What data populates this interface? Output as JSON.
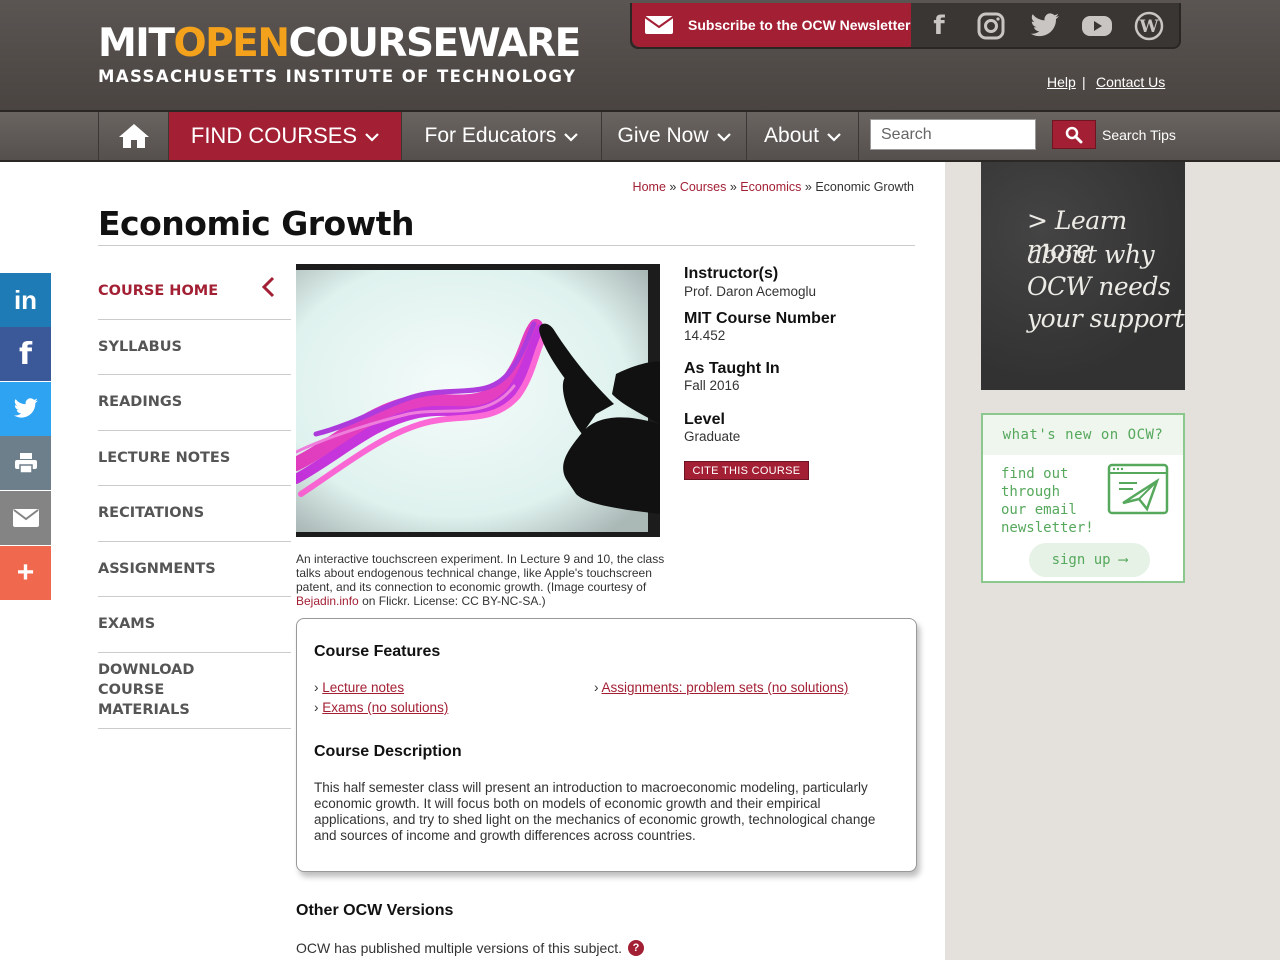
{
  "header": {
    "logo_part1": "MIT",
    "logo_part2": "OPEN",
    "logo_part3": "COURSEWARE",
    "logo_subtitle": "MASSACHUSETTS INSTITUTE OF TECHNOLOGY",
    "subscribe_label": "Subscribe to the OCW Newsletter",
    "social": [
      {
        "icon": "facebook-icon",
        "glyph": "f"
      },
      {
        "icon": "instagram-icon",
        "glyph": ""
      },
      {
        "icon": "twitter-icon",
        "glyph": ""
      },
      {
        "icon": "youtube-icon",
        "glyph": ""
      },
      {
        "icon": "wordpress-icon",
        "glyph": ""
      }
    ],
    "help": "Help",
    "separator": "|",
    "contact": "Contact Us"
  },
  "nav": {
    "find_courses": "FIND COURSES",
    "for_educators": "For Educators",
    "give_now": "Give Now",
    "about": "About",
    "search_placeholder": "Search",
    "search_tips": "Search Tips"
  },
  "breadcrumb": {
    "home": "Home",
    "courses": "Courses",
    "economics": "Economics",
    "current": "Economic Growth",
    "sep": "»"
  },
  "page_title": "Economic Growth",
  "left_nav": [
    "COURSE HOME",
    "SYLLABUS",
    "READINGS",
    "LECTURE NOTES",
    "RECITATIONS",
    "ASSIGNMENTS",
    "EXAMS",
    "DOWNLOAD COURSE MATERIALS"
  ],
  "caption": {
    "text": "An interactive touchscreen experiment. In Lecture 9 and 10, the class talks about endogenous technical change, like Apple's touchscreen patent, and its connection to economic growth. (Image courtesy of",
    "link": "Bejadin.info",
    "tail": "on Flickr. License: CC BY-NC-SA.)"
  },
  "course_info": {
    "instructor_label": "Instructor(s)",
    "instructor": "Prof. Daron Acemoglu",
    "number_label": "MIT Course Number",
    "number": "14.452",
    "taught_label": "As Taught In",
    "taught": "Fall 2016",
    "level_label": "Level",
    "level": "Graduate",
    "cite": "CITE THIS COURSE"
  },
  "features": {
    "heading": "Course Features",
    "items": [
      "Lecture notes",
      "Assignments: problem sets (no solutions)",
      "Exams (no solutions)"
    ],
    "bullet": "›"
  },
  "description": {
    "heading": "Course Description",
    "text": "This half semester class will present an introduction to macroeconomic modeling, particularly economic growth. It will focus both on models of economic growth and their empirical applications, and try to shed light on the mechanics of economic growth, technological change and sources of income and growth differences across countries."
  },
  "other_versions": {
    "heading": "Other OCW Versions",
    "text": "OCW has published multiple versions of this subject.",
    "help": "?"
  },
  "sidebar": {
    "chalk_lines": [
      "> Learn more",
      "about why",
      "OCW needs",
      "your support"
    ],
    "whats_new": "what's new on OCW?",
    "newsletter_lines": [
      "find out",
      "through",
      "our email",
      "newsletter!"
    ],
    "signup": "sign up ⟶"
  },
  "share": [
    {
      "name": "share-linkedin",
      "glyph": "in",
      "color": "#1f7bb6"
    },
    {
      "name": "share-facebook",
      "glyph": "f",
      "color": "#3b5998"
    },
    {
      "name": "share-twitter",
      "glyph": "",
      "color": "#2ea3f2"
    },
    {
      "name": "share-print",
      "glyph": "",
      "color": "#6d7f8a"
    },
    {
      "name": "share-email",
      "glyph": "",
      "color": "#848484"
    },
    {
      "name": "share-more",
      "glyph": "+",
      "color": "#f0694f"
    }
  ],
  "colors": {
    "brand": "#a31f34",
    "header_bg": "#4f4a47",
    "accent_orange": "#f4a21c"
  }
}
